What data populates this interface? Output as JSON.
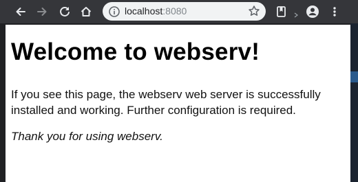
{
  "browser": {
    "address_bar": {
      "host": "localhost",
      "port": ":8080"
    },
    "icons": {
      "back": "back-arrow-icon",
      "forward": "forward-arrow-icon",
      "reload": "reload-icon",
      "home": "home-icon",
      "site_info": "info-icon",
      "bookmark": "star-icon",
      "reading_list": "reading-list-icon",
      "account": "account-icon",
      "menu": "more-vert-icon"
    }
  },
  "page": {
    "heading": "Welcome to webserv!",
    "body": "If you see this page, the webserv web server is successfully installed and working. Further configuration is required.",
    "thanks": "Thank you for using webserv."
  }
}
